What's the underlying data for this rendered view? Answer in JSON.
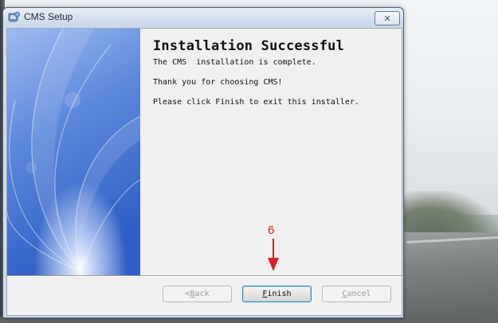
{
  "window": {
    "title": "CMS Setup",
    "close_label": "✕",
    "app_icon": "installer-icon"
  },
  "content": {
    "heading": "Installation Successful",
    "line1": "The CMS  installation is complete.",
    "line2": "Thank you for choosing CMS!",
    "line3": "Please click Finish to exit this installer."
  },
  "buttons": {
    "back": {
      "accel": "B",
      "rest": "ack",
      "prefix": "< ",
      "enabled": false
    },
    "finish": {
      "accel": "F",
      "rest": "inish",
      "enabled": true
    },
    "cancel": {
      "accel": "C",
      "rest": "ancel",
      "enabled": false
    }
  },
  "annotation": {
    "step_number": "6",
    "color": "#e02020"
  },
  "colors": {
    "banner_top": "#8fb2ea",
    "banner_bottom": "#2f62c8",
    "dialog_bg": "#f0f0f0"
  }
}
